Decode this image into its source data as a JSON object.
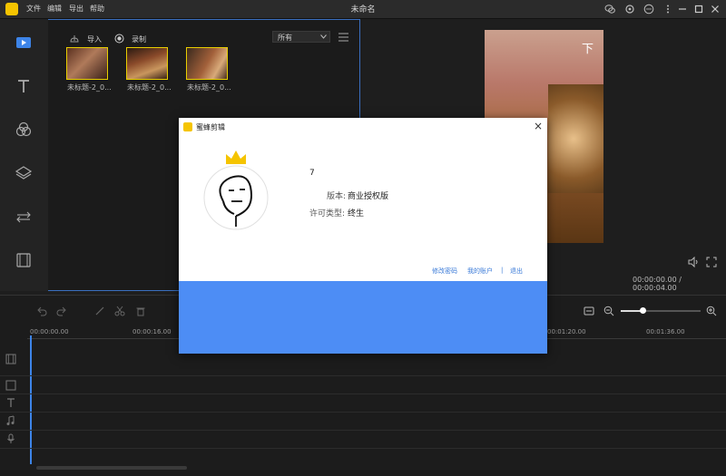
{
  "app": {
    "title": "未命名",
    "menu": [
      "文件",
      "编辑",
      "导出",
      "帮助"
    ]
  },
  "media": {
    "import_label": "导入",
    "record_label": "录制",
    "filter_value": "所有",
    "clips": [
      {
        "label": "未标题-2_0..."
      },
      {
        "label": "未标题-2_0..."
      },
      {
        "label": "未标题-2_0..."
      }
    ]
  },
  "preview": {
    "caption_char": "下",
    "time_display": "00:00:00.00 / 00:00:04.00"
  },
  "timeline": {
    "ruler": [
      "00:00:00.00",
      "00:00:16.00",
      "00:01:20.00",
      "00:01:36.00"
    ]
  },
  "dialog": {
    "title": "蜜蜂剪辑",
    "version_number": "7",
    "edition_label": "版本:",
    "edition_value": "商业授权版",
    "license_label": "许可类型:",
    "license_value": "终生",
    "links": {
      "change_password": "修改密码",
      "my_account": "我的账户",
      "separator": "|",
      "logout": "退出"
    },
    "close_glyph": "×"
  },
  "colors": {
    "accent": "#4d8df5",
    "brand": "#f5c400",
    "selection": "#e8cf00"
  }
}
